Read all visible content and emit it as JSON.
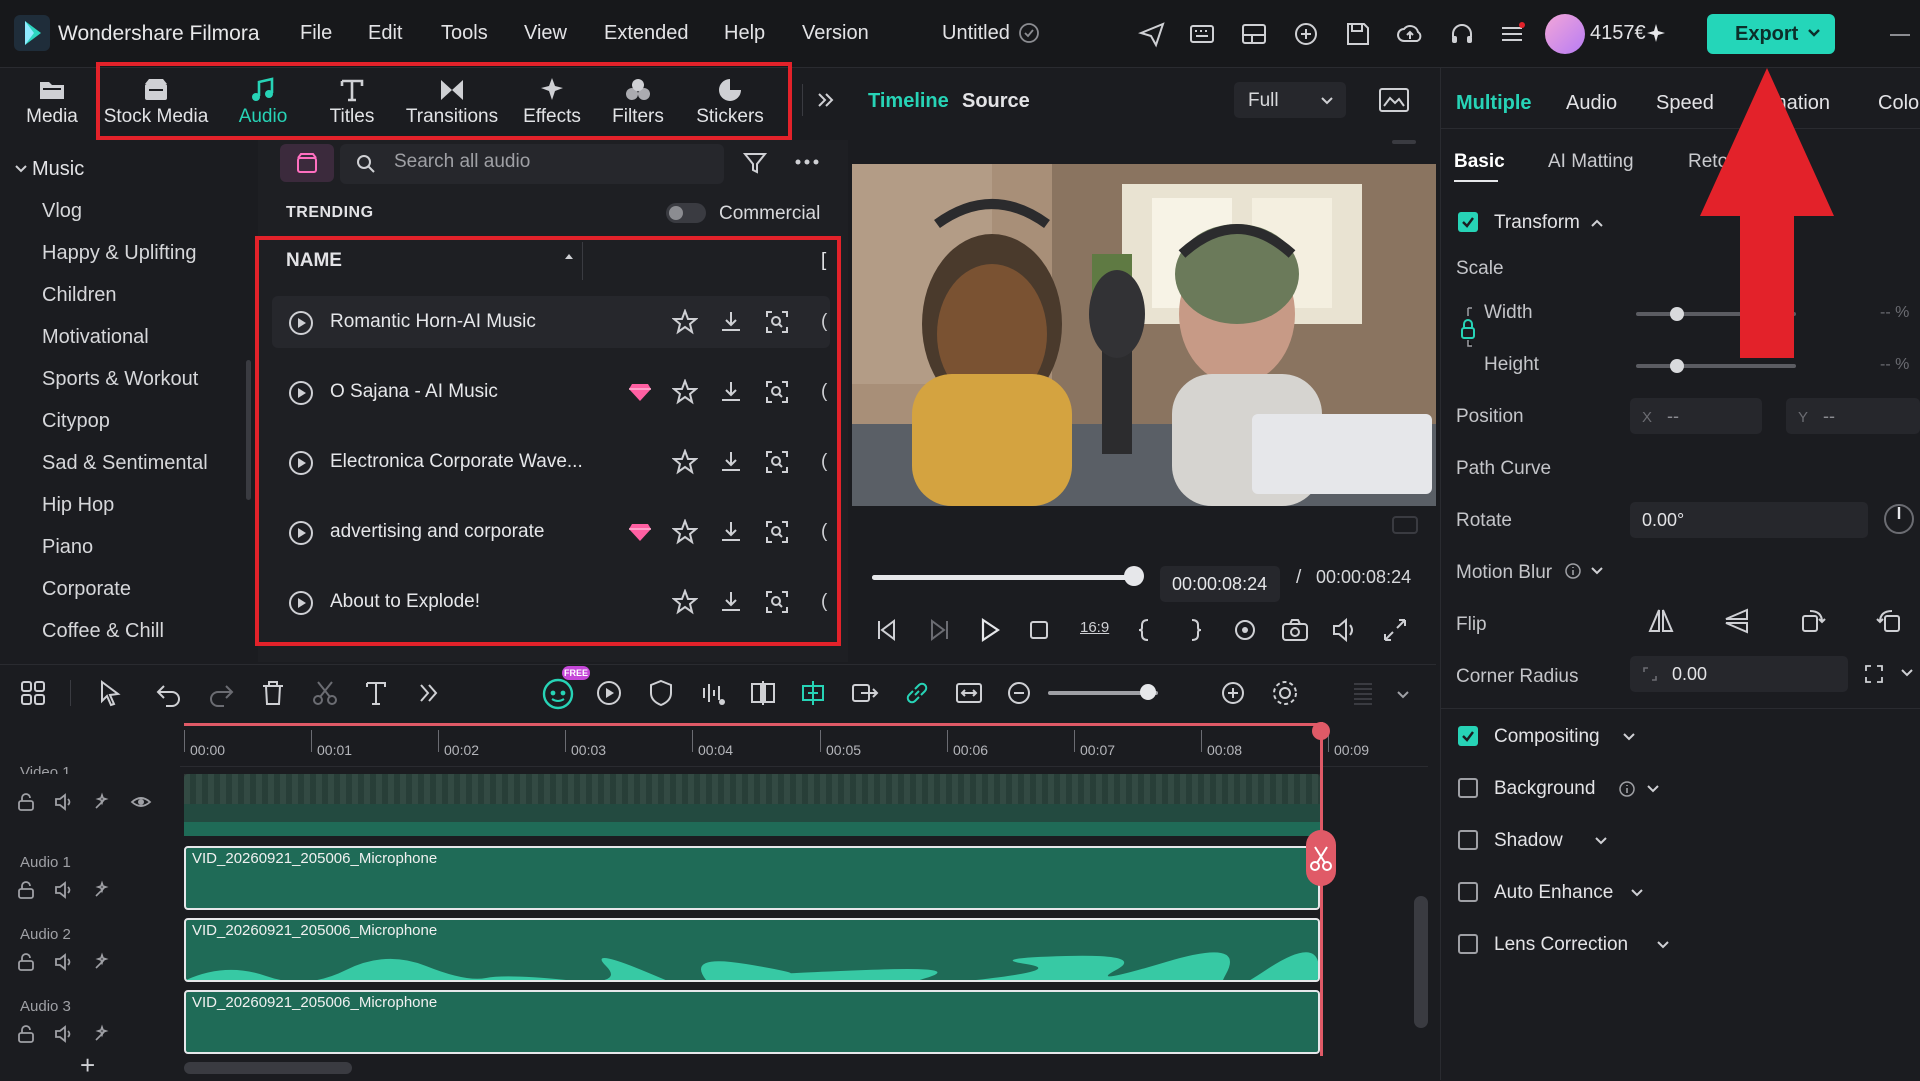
{
  "app": {
    "name": "Wondershare Filmora",
    "project_title": "Untitled",
    "credits": "4157€",
    "export_label": "Export"
  },
  "menu": [
    "File",
    "Edit",
    "Tools",
    "View",
    "Extended",
    "Help",
    "Version"
  ],
  "tool_tabs": [
    {
      "label": "Media",
      "icon": "folder-icon"
    },
    {
      "label": "Stock Media",
      "icon": "stock-media-icon"
    },
    {
      "label": "Audio",
      "icon": "music-note-icon"
    },
    {
      "label": "Titles",
      "icon": "titles-icon"
    },
    {
      "label": "Transitions",
      "icon": "transitions-icon"
    },
    {
      "label": "Effects",
      "icon": "effects-icon"
    },
    {
      "label": "Filters",
      "icon": "filters-icon"
    },
    {
      "label": "Stickers",
      "icon": "stickers-icon"
    }
  ],
  "active_tool_tab": "Audio",
  "sidebar": {
    "header": "Music",
    "items": [
      "Vlog",
      "Happy & Uplifting",
      "Children",
      "Motivational",
      "Sports & Workout",
      "Citypop",
      "Sad & Sentimental",
      "Hip Hop",
      "Piano",
      "Corporate",
      "Coffee & Chill"
    ]
  },
  "audio_panel": {
    "search_placeholder": "Search all audio",
    "section": "TRENDING",
    "commercial_label": "Commercial",
    "column_name": "NAME",
    "column_extra": "[",
    "tracks": [
      {
        "title": "Romantic Horn-AI Music",
        "premium": false
      },
      {
        "title": "O Sajana - AI Music",
        "premium": true
      },
      {
        "title": "Electronica Corporate Wave...",
        "premium": false
      },
      {
        "title": "advertising and corporate",
        "premium": true
      },
      {
        "title": "About to Explode!",
        "premium": false
      }
    ],
    "row_edge": "("
  },
  "preview": {
    "tab_timeline": "Timeline",
    "tab_source": "Source",
    "quality": "Full",
    "current_time": "00:00:08:24",
    "separator": "/",
    "total_time": "00:00:08:24",
    "progress": 1.0,
    "aspect_label": "16:9"
  },
  "properties": {
    "tabs": [
      "Multiple",
      "Audio",
      "Speed",
      "Animation",
      "Colo"
    ],
    "tab_visible": [
      "Multiple",
      "Audio",
      "Speed",
      "mation",
      "Colo"
    ],
    "subtabs": [
      "Basic",
      "AI Matting",
      "Reto"
    ],
    "transform": "Transform",
    "scale": "Scale",
    "width": "Width",
    "height": "Height",
    "width_value": "-- %",
    "height_value": "-- %",
    "position": "Position",
    "pos_x_label": "X",
    "pos_x": "--",
    "pos_y_label": "Y",
    "pos_y": "--",
    "path_curve": "Path Curve",
    "rotate": "Rotate",
    "rotate_value": "0.00°",
    "motion_blur": "Motion Blur",
    "flip": "Flip",
    "corner_radius": "Corner Radius",
    "corner_value": "0.00",
    "sections": [
      {
        "label": "Compositing",
        "checked": true
      },
      {
        "label": "Background",
        "checked": false
      },
      {
        "label": "Shadow",
        "checked": false
      },
      {
        "label": "Auto Enhance",
        "checked": false
      },
      {
        "label": "Lens Correction",
        "checked": false
      }
    ]
  },
  "timeline": {
    "ruler": [
      "00:00",
      "00:01",
      "00:02",
      "00:03",
      "00:04",
      "00:05",
      "00:06",
      "00:07",
      "00:08",
      "00:09"
    ],
    "video_track_label": "Video 1",
    "audio_tracks": [
      {
        "label": "Audio 1",
        "clip": "VID_20260921_205006_Microphone"
      },
      {
        "label": "Audio 2",
        "clip": "VID_20260921_205006_Microphone"
      },
      {
        "label": "Audio 3",
        "clip": "VID_20260921_205006_Microphone"
      }
    ],
    "add_track": "+",
    "free_badge": "FREE"
  },
  "colors": {
    "accent": "#27d3b6",
    "highlight_box": "#e3222a",
    "playhead": "#e05a67",
    "clip": "#1f6b57",
    "premium_gem": "#ff5fa2"
  }
}
